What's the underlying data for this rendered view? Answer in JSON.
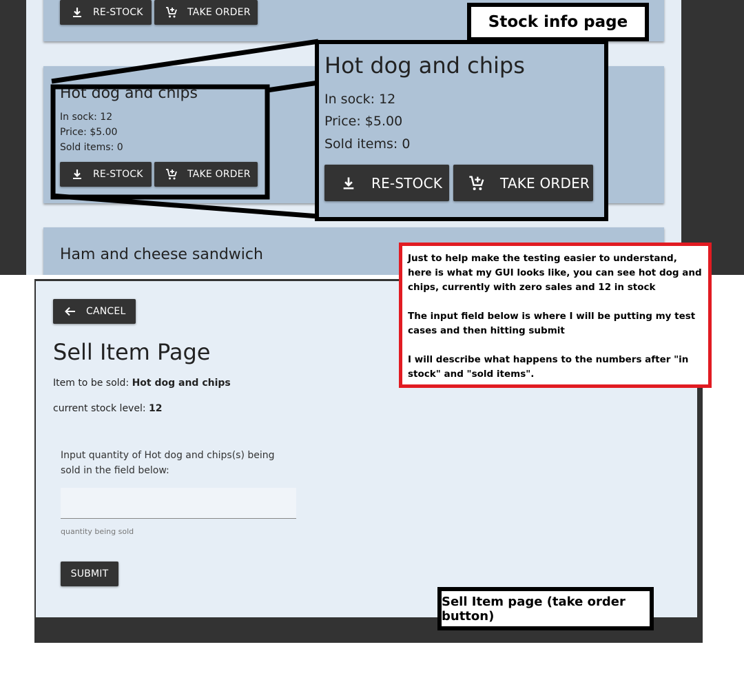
{
  "top_screenshot": {
    "top_card": {
      "restock_label": "RE-STOCK",
      "take_order_label": "TAKE ORDER"
    },
    "hotdog_card": {
      "title": "Hot dog and chips",
      "stock": "In sock: 12",
      "price": "Price: $5.00",
      "sold": "Sold items: 0",
      "restock_label": "RE-STOCK",
      "take_order_label": "TAKE ORDER"
    },
    "sandwich_card": {
      "title": "Ham and cheese sandwich"
    },
    "label": "Stock info page"
  },
  "zoom": {
    "title": "Hot dog and chips",
    "stock": "In sock: 12",
    "price": "Price: $5.00",
    "sold": "Sold items: 0",
    "restock_label": "RE-STOCK",
    "take_order_label": "TAKE ORDER"
  },
  "note": {
    "p1": "Just to help make the testing easier to understand, here is what my GUI looks like, you can see hot dog and chips, currently with zero sales and 12 in stock",
    "p2": "The input field below is where I will be putting my test cases and then hitting submit",
    "p3": "I will describe what happens to the numbers after \"in stock\" and \"sold items\"."
  },
  "sell_page": {
    "cancel_label": "CANCEL",
    "title": "Sell Item Page",
    "item_prefix": "Item to be sold: ",
    "item_name": "Hot dog and chips",
    "stock_prefix": "current stock level: ",
    "stock_value": "12",
    "instruction": "Input quantity of Hot dog and chips(s) being sold in the field below:",
    "input_value": "",
    "helper_text": "quantity being sold",
    "submit_label": "SUBMIT",
    "label": "Sell Item page (take order button)"
  },
  "colors": {
    "card_bg": "#aec2d6",
    "page_bg": "#e5edf5",
    "button_bg": "#333333",
    "note_border": "#e11b22"
  }
}
